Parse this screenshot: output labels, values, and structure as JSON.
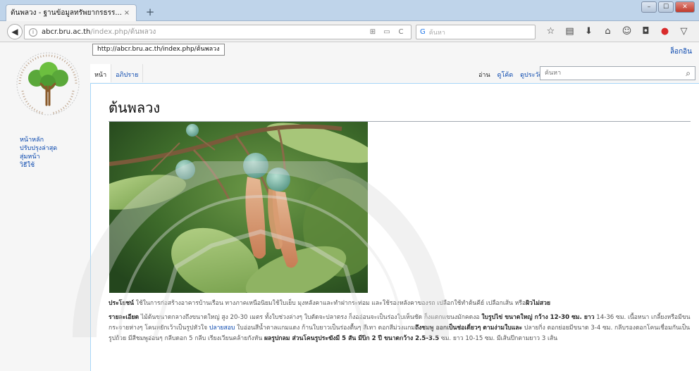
{
  "browser": {
    "tab_title": "ต้นพลวง - ฐานข้อมูลทรัพยากรธรร...",
    "tab_close": "×",
    "new_tab": "+",
    "window_controls": [
      "–",
      "☐",
      "✕"
    ],
    "back": "◀",
    "url_host": "abcr.bru.ac.th",
    "url_path": "/index.php/ต้นพลวง",
    "url_tools": [
      "⊞",
      "▭",
      "C"
    ],
    "search_engine": "G",
    "search_placeholder": "ค้นหา",
    "toolbar_icons": [
      {
        "glyph": "☆",
        "name": "bookmark-star-icon"
      },
      {
        "glyph": "▤",
        "name": "reading-list-icon"
      },
      {
        "glyph": "⬇",
        "name": "download-icon"
      },
      {
        "glyph": "⌂",
        "name": "home-icon"
      },
      {
        "glyph": "☺",
        "name": "chat-icon"
      },
      {
        "glyph": "◘",
        "name": "pocket-icon"
      },
      {
        "glyph": "●",
        "name": "adblock-icon"
      },
      {
        "glyph": "▽",
        "name": "shield-icon"
      },
      {
        "glyph": "≡",
        "name": "menu-icon"
      }
    ],
    "status_url": "http://abcr.bru.ac.th/index.php/ต้นพลวง"
  },
  "wiki": {
    "login": "ล็อกอิน",
    "sidebar": [
      "หน้าหลัก",
      "ปรับปรุงล่าสุด",
      "สุ่มหน้า",
      "วิธีใช้"
    ],
    "tabs_left": [
      "หน้า",
      "อภิปราย"
    ],
    "tabs_right": [
      "อ่าน",
      "ดูโค้ด",
      "ดูประวัติ"
    ],
    "search_placeholder": "ค้นหา",
    "search_icon": "⌕",
    "title": "ต้นพลวง",
    "benefit_label": "ประโยชน์",
    "benefit_text": " ใช้ในการก่อสร้างอาคารบ้านเรือน ทางภาคเหนือนิยมใช้ใบเย็บ มุงหลังคาและทำฝากระท่อม และใช้รองหลังคาของรถ เปลือกใช้ทำต้นคีย์ เปลือกเส้น หรือ",
    "benefit_hl": "ผิวไม่สวย",
    "detail_label": "รายละเอียด",
    "detail_a": " ไม้ต้นขนาดกลางถึงขนาดใหญ่ สูง 20-30 เมตร ทั้งใบช่วงล่างๆ ใบตัดจะปลาตรง ก็งออ่อนจะเป็นร่องใบเห็นชัด ก็งแตกแขนงมักคดงอ ",
    "detail_hl1": "ใบรูปไข่ ขนาดใหญ่ กว้าง 12-30 ซม. ยาว",
    "detail_b": " 14-36 ซม. เนื้อหนา เกลี้ยงหรือมีขนกระจายห่างๆ โคนหยักเว้าเป็นรูปหัวใจ ",
    "detail_link": "ปลายสอบ",
    "detail_c": " ใบอ่อนสีน้ำตาลแกมแดง ก้านใบยาวเป็นร่องตื้นๆ สีเทา ดอกสีม่วงแกม",
    "detail_hl2": "ถึงชมพู ออกเป็นช่อเดี่ยวๆ ตามง่ามใบและ",
    "detail_d": " ปลายกิ่ง ดอกย่อยมีขนาด 3-4 ซม. กลีบรองดอกโคนเชื่อมกันเป็นรูปถ้วย มีสีชมพูอ่อนๆ กลีบดอก 5 กลีบ เรียงเวียนคล้ายกังหัน ",
    "detail_hl3": "ผลรูปกลม ส่วนโคนรูประฆังมี 5 สัน มีปีก 2 ปี ขนาดกว้าง 2.5-3.5",
    "detail_e": " ซม. ยาว 10-15 ซม. มีเส้นปีกตามยาว 3 เส้น"
  },
  "colors": {
    "link": "#0645ad",
    "tabbar": "#bfd4ea",
    "leaf_dark": "#3f6b2a",
    "leaf_light": "#8bbb5a",
    "fruit": "#7fb6a6",
    "calyx": "#d39a72",
    "logo_green": "#5aa83a",
    "logo_trunk": "#8a5a2b"
  }
}
